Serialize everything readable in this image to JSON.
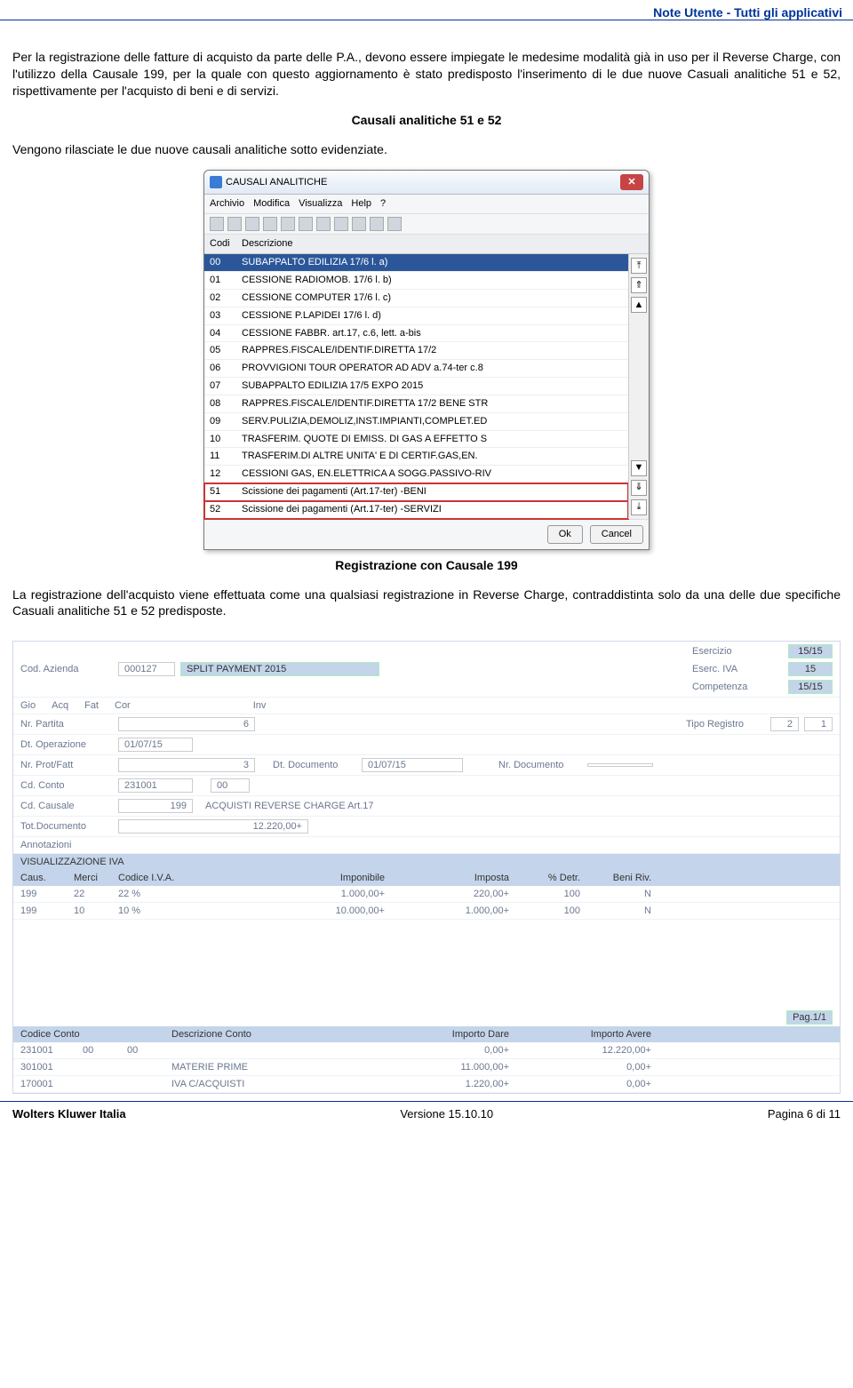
{
  "header": {
    "title": "Note Utente - Tutti gli applicativi"
  },
  "p1": "Per la registrazione delle fatture di acquisto da parte delle P.A., devono essere impiegate le medesime modalità già in uso per il Reverse Charge, con l'utilizzo della Causale 199, per la quale con questo aggiornamento è stato predisposto l'inserimento di le due nuove Casuali analitiche 51 e 52, rispettivamente per l'acquisto di beni e di servizi.",
  "heading1": "Causali analitiche 51 e 52",
  "p2": "Vengono rilasciate le due nuove causali analitiche sotto evidenziate.",
  "window": {
    "title": "CAUSALI ANALITICHE",
    "menu": [
      "Archivio",
      "Modifica",
      "Visualizza",
      "Help",
      "?"
    ],
    "cols": {
      "codi": "Codi",
      "desc": "Descrizione"
    },
    "rows": [
      {
        "c": "00",
        "d": "SUBAPPALTO EDILIZIA 17/6 l. a)",
        "sel": true
      },
      {
        "c": "01",
        "d": "CESSIONE RADIOMOB. 17/6 l. b)"
      },
      {
        "c": "02",
        "d": "CESSIONE COMPUTER 17/6 l. c)"
      },
      {
        "c": "03",
        "d": "CESSIONE P.LAPIDEI 17/6 l. d)"
      },
      {
        "c": "04",
        "d": "CESSIONE FABBR. art.17, c.6, lett. a-bis"
      },
      {
        "c": "05",
        "d": "RAPPRES.FISCALE/IDENTIF.DIRETTA 17/2"
      },
      {
        "c": "06",
        "d": "PROVVIGIONI TOUR OPERATOR AD ADV a.74-ter c.8"
      },
      {
        "c": "07",
        "d": "SUBAPPALTO EDILIZIA 17/5 EXPO 2015"
      },
      {
        "c": "08",
        "d": "RAPPRES.FISCALE/IDENTIF.DIRETTA 17/2 BENE STR"
      },
      {
        "c": "09",
        "d": "SERV.PULIZIA,DEMOLIZ,INST.IMPIANTI,COMPLET.ED"
      },
      {
        "c": "10",
        "d": "TRASFERIM. QUOTE DI EMISS. DI GAS A EFFETTO S"
      },
      {
        "c": "11",
        "d": "TRASFERIM.DI ALTRE UNITA' E DI CERTIF.GAS,EN."
      },
      {
        "c": "12",
        "d": "CESSIONI GAS, EN.ELETTRICA A SOGG.PASSIVO-RIV"
      },
      {
        "c": "51",
        "d": "Scissione dei pagamenti (Art.17-ter) -BENI",
        "box": true
      },
      {
        "c": "52",
        "d": "Scissione dei pagamenti (Art.17-ter) -SERVIZI",
        "box": true
      }
    ],
    "buttons": {
      "ok": "Ok",
      "cancel": "Cancel"
    }
  },
  "heading2": "Registrazione con Causale 199",
  "p3": "La registrazione dell'acquisto viene effettuata come una qualsiasi registrazione in Reverse Charge, contraddistinta solo da una delle due specifiche Casuali analitiche 51 e 52 predisposte.",
  "form": {
    "labels": {
      "codaz": "Cod. Azienda",
      "eser": "Esercizio",
      "eseriva": "Eserc. IVA",
      "comp": "Competenza",
      "gio": "Gio",
      "acq": "Acq",
      "fat": "Fat",
      "cor": "Cor",
      "inv": "Inv",
      "nrpart": "Nr. Partita",
      "tiporeg": "Tipo Registro",
      "dtop": "Dt. Operazione",
      "nrprot": "Nr. Prot/Fatt",
      "dtdoc": "Dt. Documento",
      "nrdoc": "Nr. Documento",
      "cdconto": "Cd. Conto",
      "cdcaus": "Cd. Causale",
      "totdoc": "Tot.Documento",
      "annot": "Annotazioni"
    },
    "values": {
      "codaz": "000127",
      "codazdesc": "SPLIT PAYMENT 2015",
      "eser": "15/15",
      "eseriva": "15",
      "comp": "15/15",
      "nrpart": "6",
      "tiporeg1": "2",
      "tiporeg2": "1",
      "dtop": "01/07/15",
      "nrprot": "3",
      "dtdoc": "01/07/15",
      "cdconto1": "231001",
      "cdconto2": "00",
      "cdcaus": "199",
      "cdcausdesc": "ACQUISTI REVERSE CHARGE Art.17",
      "totdoc": "12.220,00+"
    },
    "iva": {
      "surtitle": "VISUALIZZAZIONE IVA",
      "hdr": {
        "caus": "Caus.",
        "merci": "Merci",
        "civa": "Codice I.V.A.",
        "imp": "Imponibile",
        "impos": "Imposta",
        "det": "% Detr.",
        "ben": "Beni Riv."
      },
      "rows": [
        {
          "caus": "199",
          "merci": "22",
          "civa": "22 %",
          "imp": "1.000,00+",
          "impos": "220,00+",
          "det": "100",
          "ben": "N"
        },
        {
          "caus": "199",
          "merci": "10",
          "civa": "10 %",
          "imp": "10.000,00+",
          "impos": "1.000,00+",
          "det": "100",
          "ben": "N"
        }
      ],
      "pag": "Pag.1/1"
    },
    "conto": {
      "hdr": {
        "cc": "Codice Conto",
        "dc": "Descrizione Conto",
        "id": "Importo Dare",
        "ia": "Importo Avere"
      },
      "rows": [
        {
          "cc1": "231001",
          "cc1b": "00",
          "cc2": "00",
          "dc": "",
          "id": "0,00+",
          "ia": "12.220,00+"
        },
        {
          "cc1": "301001",
          "cc1b": "",
          "cc2": "",
          "dc": "MATERIE PRIME",
          "id": "11.000,00+",
          "ia": "0,00+"
        },
        {
          "cc1": "170001",
          "cc1b": "",
          "cc2": "",
          "dc": "IVA C/ACQUISTI",
          "id": "1.220,00+",
          "ia": "0,00+"
        }
      ]
    }
  },
  "footer": {
    "left": "Wolters Kluwer Italia",
    "center": "Versione 15.10.10",
    "right": "Pagina 6 di 11"
  }
}
